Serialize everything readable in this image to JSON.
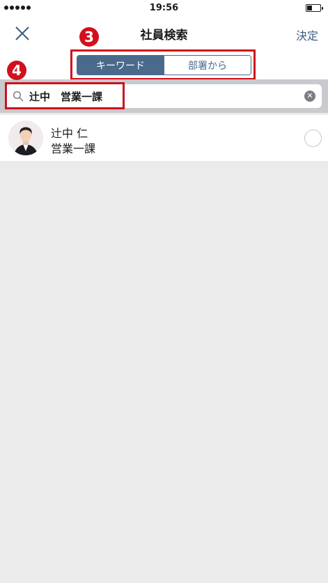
{
  "status_bar": {
    "time": "19:56"
  },
  "nav": {
    "title": "社員検索",
    "done_label": "決定"
  },
  "segments": {
    "keyword": "キーワード",
    "department": "部署から"
  },
  "annotations": {
    "three": "3",
    "four": "4"
  },
  "search": {
    "value": "辻中　営業一課"
  },
  "results": [
    {
      "name": "辻中 仁",
      "department": "営業一課"
    }
  ],
  "colors": {
    "accent": "#4a6a8c",
    "annotation": "#d0101c",
    "link": "#3e5d80"
  }
}
